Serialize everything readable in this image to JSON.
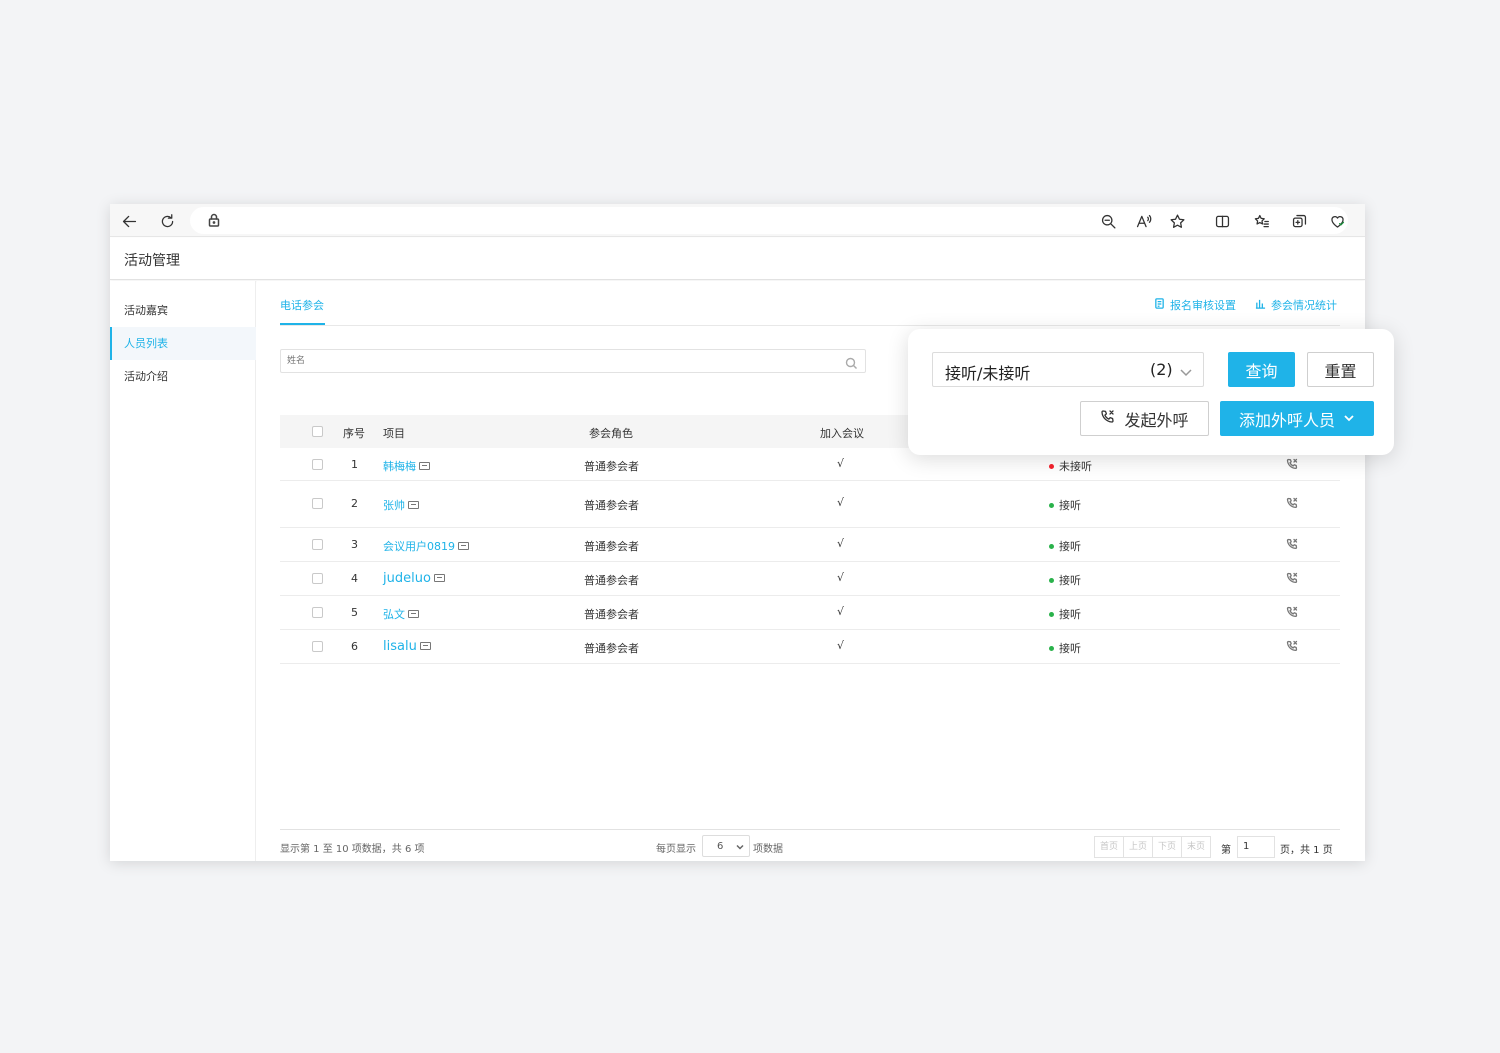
{
  "app": {
    "title": "活动管理"
  },
  "sidebar": {
    "items": [
      {
        "label": "活动嘉宾",
        "active": false
      },
      {
        "label": "人员列表",
        "active": true
      },
      {
        "label": "活动介绍",
        "active": false
      }
    ]
  },
  "tabs": {
    "active_label": "电话参会"
  },
  "top_links": {
    "signup_review": "报名审核设置",
    "attendance_stats": "参会情况统计"
  },
  "search": {
    "placeholder": "姓名"
  },
  "table": {
    "headers": {
      "index": "序号",
      "project": "项目",
      "role": "参会角色",
      "joined": "加入会议"
    },
    "rows": [
      {
        "index": "1",
        "name": "韩梅梅",
        "role": "普通参会者",
        "joined": "√",
        "status": "未接听",
        "status_color": "#f5222d"
      },
      {
        "index": "2",
        "name": "张帅",
        "role": "普通参会者",
        "joined": "√",
        "status": "接听",
        "status_color": "#2ab24b"
      },
      {
        "index": "3",
        "name": "会议用户0819",
        "role": "普通参会者",
        "joined": "√",
        "status": "接听",
        "status_color": "#2ab24b"
      },
      {
        "index": "4",
        "name": "judeluo",
        "role": "普通参会者",
        "joined": "√",
        "status": "接听",
        "status_color": "#2ab24b"
      },
      {
        "index": "5",
        "name": "弘文",
        "role": "普通参会者",
        "joined": "√",
        "status": "接听",
        "status_color": "#2ab24b"
      },
      {
        "index": "6",
        "name": "lisalu",
        "role": "普通参会者",
        "joined": "√",
        "status": "接听",
        "status_color": "#2ab24b"
      }
    ]
  },
  "footer": {
    "info": "显示第 1 至 10 项数据，共 6 项",
    "page_size_label": "每页显示",
    "page_size_value": "6",
    "page_size_unit": "项数据",
    "first": "首页",
    "prev": "上页",
    "next": "下页",
    "last": "末页",
    "page_prefix": "第",
    "page_value": "1",
    "page_suffix": "页，共 1 页"
  },
  "popup": {
    "status_filter_label": "接听/未接听",
    "status_filter_count": "(2)",
    "query_label": "查询",
    "reset_label": "重置",
    "call_label": "发起外呼",
    "add_label": "添加外呼人员"
  },
  "colors": {
    "accent": "#1fb3e8",
    "answered": "#2ab24b",
    "missed": "#f5222d"
  },
  "icons": {
    "toolbar": [
      "back-arrow-icon",
      "refresh-icon",
      "lock-icon",
      "zoom-icon",
      "read-aloud-icon",
      "favorite-star-icon",
      "split-screen-icon",
      "favorites-list-icon",
      "collections-icon",
      "browser-essentials-icon"
    ],
    "rows": "phone-call-icon"
  }
}
